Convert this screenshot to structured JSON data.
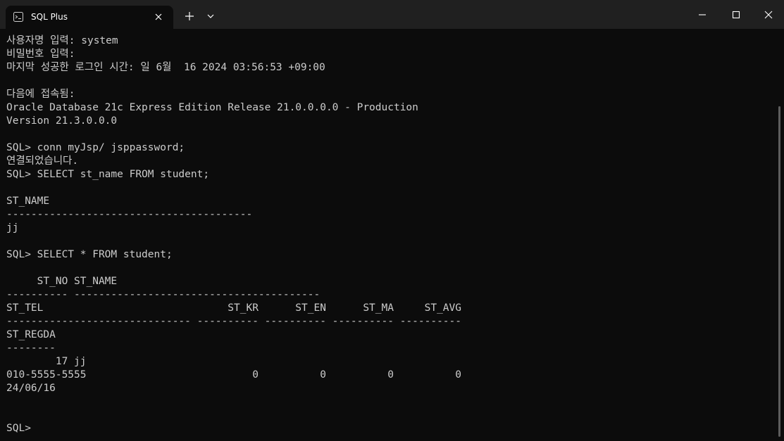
{
  "window": {
    "tab_title": "SQL Plus",
    "new_tab_glyph": "+"
  },
  "icons": {
    "tab": "terminal-icon",
    "tab_close": "close-icon",
    "new_tab": "plus-icon",
    "dropdown": "chevron-down-icon",
    "minimize": "minimize-icon",
    "maximize": "maximize-icon",
    "close": "close-icon"
  },
  "colors": {
    "background": "#0c0c0c",
    "titlebar": "#202020",
    "text": "#cccccc",
    "scrollbar": "#5d5d5d"
  },
  "console": {
    "lines": [
      "사용자명 입력: system",
      "비밀번호 입력:",
      "마지막 성공한 로그인 시간: 일 6월  16 2024 03:56:53 +09:00",
      "",
      "다음에 접속됨:",
      "Oracle Database 21c Express Edition Release 21.0.0.0.0 - Production",
      "Version 21.3.0.0.0",
      "",
      "SQL> conn myJsp/ jsppassword;",
      "연결되었습니다.",
      "SQL> SELECT st_name FROM student;",
      "",
      "ST_NAME",
      "----------------------------------------",
      "jj",
      "",
      "SQL> SELECT * FROM student;",
      "",
      "     ST_NO ST_NAME",
      "---------- ----------------------------------------",
      "ST_TEL                              ST_KR      ST_EN      ST_MA     ST_AVG",
      "------------------------------ ---------- ---------- ---------- ----------",
      "ST_REGDA",
      "--------",
      "        17 jj",
      "010-5555-5555                           0          0          0          0",
      "24/06/16",
      "",
      "",
      "SQL>"
    ]
  }
}
